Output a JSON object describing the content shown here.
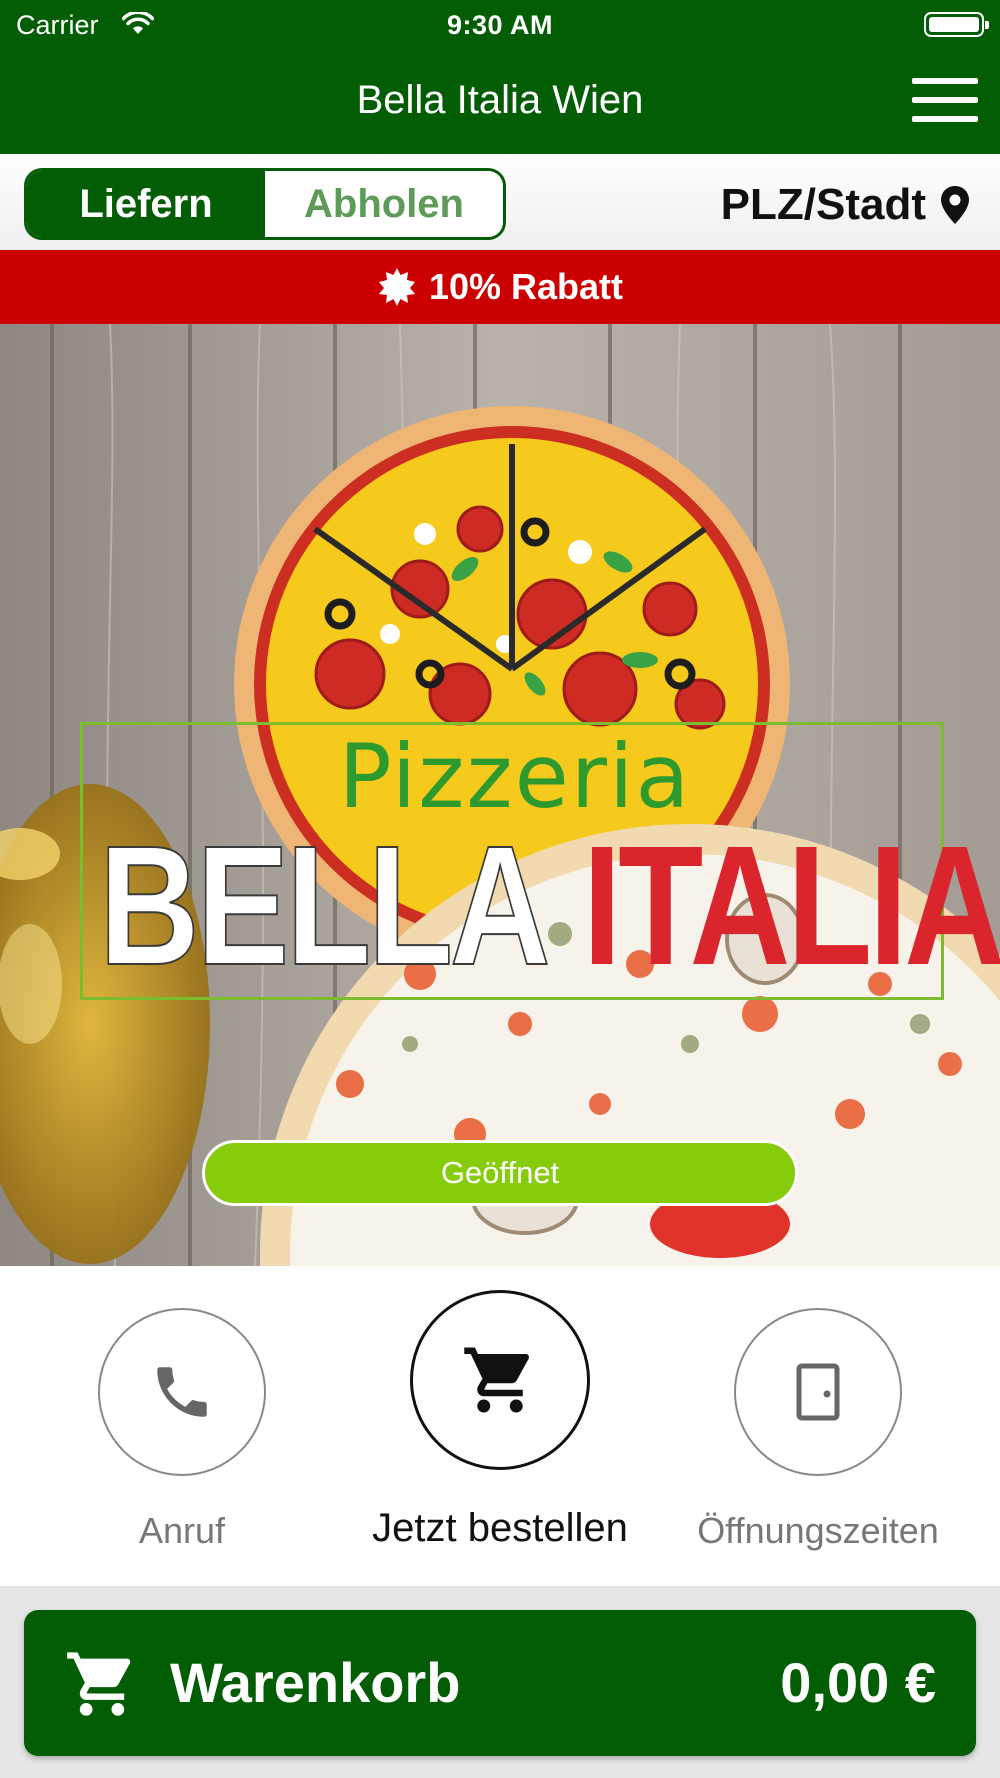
{
  "status_bar": {
    "carrier": "Carrier",
    "time": "9:30 AM"
  },
  "header": {
    "title": "Bella Italia Wien"
  },
  "mode": {
    "deliver": "Liefern",
    "pickup": "Abholen",
    "active": "deliver"
  },
  "location": {
    "label": "PLZ/Stadt"
  },
  "banner": {
    "text": "10% Rabatt"
  },
  "hero": {
    "logo_top": "Pizzeria",
    "logo_word1": "BELLA",
    "logo_word2": "ITALIA",
    "status": "Geöffnet"
  },
  "actions": {
    "call": "Anruf",
    "order": "Jetzt bestellen",
    "hours": "Öffnungszeiten"
  },
  "cart": {
    "label": "Warenkorb",
    "total": "0,00 €"
  },
  "colors": {
    "primary": "#035d05",
    "banner": "#cc0000",
    "open": "#86cc0a",
    "italia_red": "#d9252b"
  }
}
